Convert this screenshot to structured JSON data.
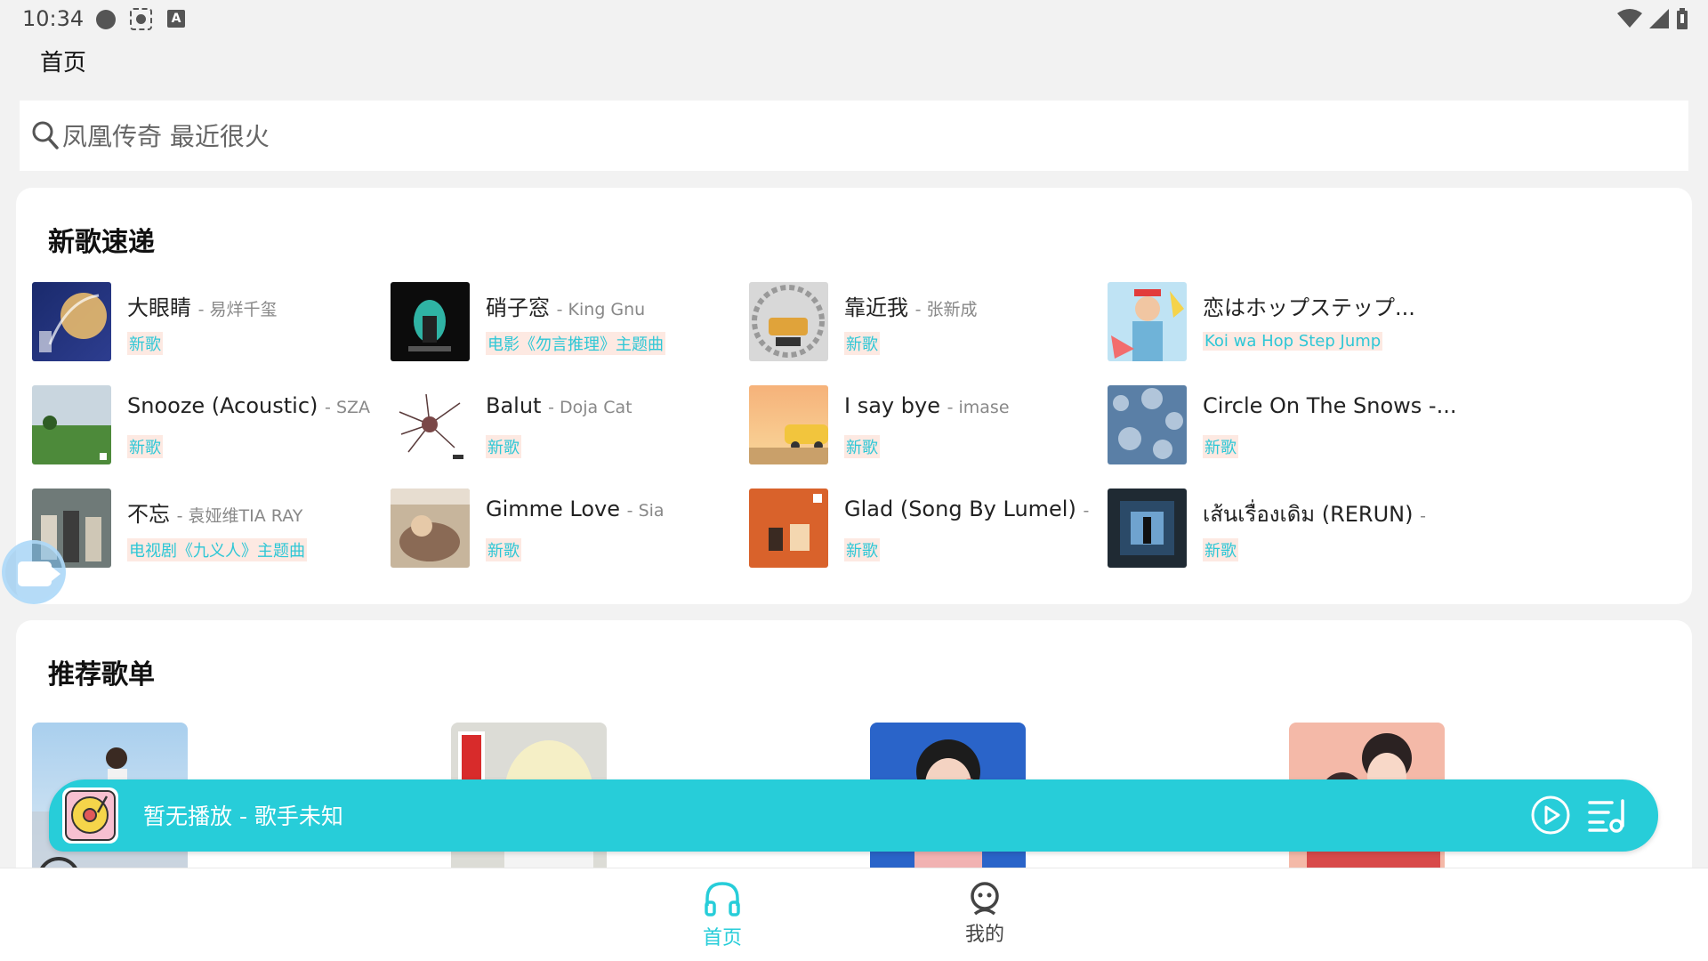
{
  "status": {
    "time": "10:34"
  },
  "header": {
    "title": "首页"
  },
  "search": {
    "placeholder": "凤凰传奇 最近很火"
  },
  "new_songs": {
    "title": "新歌速递",
    "items": [
      {
        "title": "大眼睛",
        "artist": "- 易烊千玺",
        "tag": "新歌"
      },
      {
        "title": "硝子窓",
        "artist": "- King Gnu",
        "tag": "电影《勿言推理》主题曲"
      },
      {
        "title": "靠近我",
        "artist": "- 张新成",
        "tag": "新歌"
      },
      {
        "title": "恋はホップステップ...",
        "artist": "",
        "tag": "Koi wa Hop Step Jump"
      },
      {
        "title": "Snooze (Acoustic)",
        "artist": "- SZA",
        "tag": "新歌"
      },
      {
        "title": "Balut",
        "artist": "- Doja Cat",
        "tag": "新歌"
      },
      {
        "title": "I say bye",
        "artist": "- imase",
        "tag": "新歌"
      },
      {
        "title": "Circle On The Snows -...",
        "artist": "",
        "tag": "新歌"
      },
      {
        "title": "不忘",
        "artist": "- 袁娅维TIA RAY",
        "tag": "电视剧《九义人》主题曲"
      },
      {
        "title": "Gimme Love",
        "artist": "- Sia",
        "tag": "新歌"
      },
      {
        "title": "Glad (Song By Lumel)",
        "artist": "-",
        "tag": "新歌"
      },
      {
        "title": "เส้นเรื่องเดิม (RERUN)",
        "artist": "-",
        "tag": "新歌"
      }
    ]
  },
  "recommended": {
    "title": "推荐歌单"
  },
  "player": {
    "now_playing": "暂无播放 - 歌手未知"
  },
  "nav": {
    "home": "首页",
    "mine": "我的"
  },
  "colors": {
    "accent": "#27cdd9",
    "tag_bg": "#fde9e2",
    "tag_text": "#2ec7d6"
  }
}
